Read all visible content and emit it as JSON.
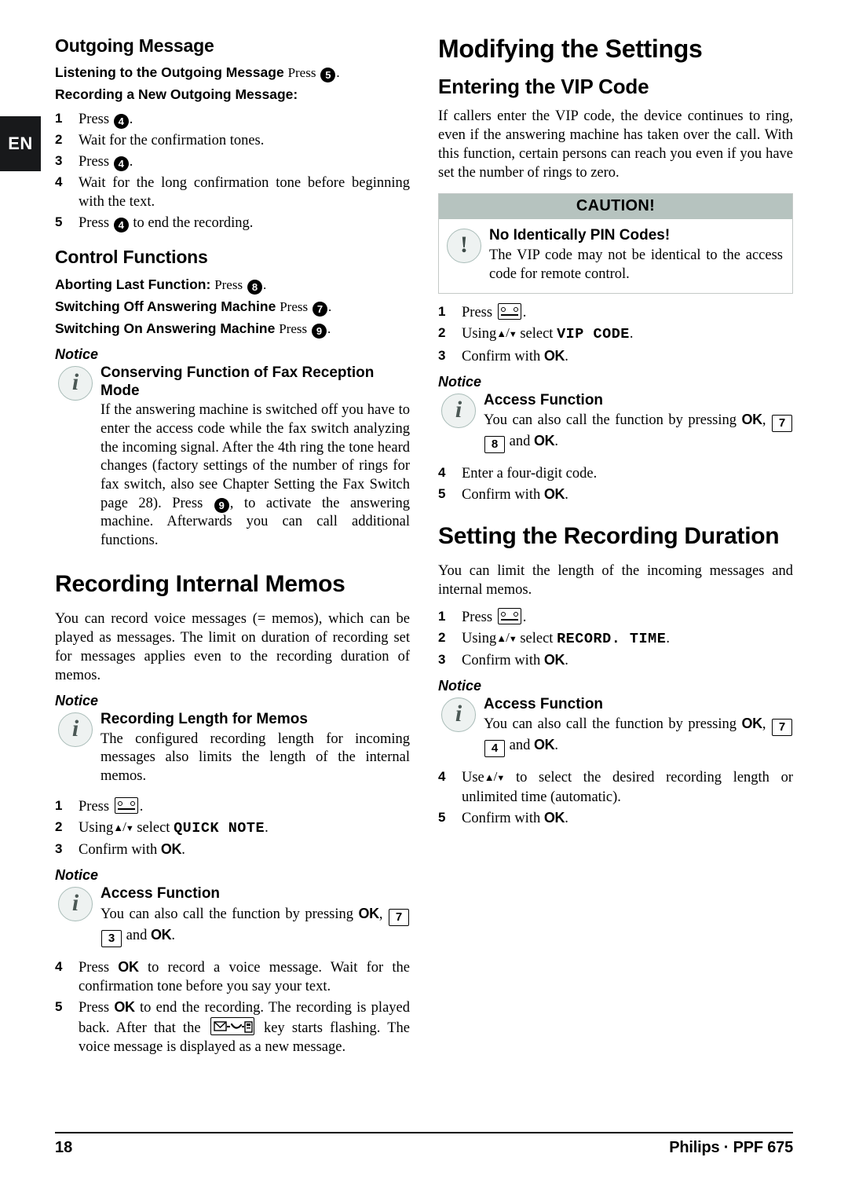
{
  "page": {
    "language_tab": "EN",
    "footer": {
      "page_number": "18",
      "product": "Philips · PPF 675"
    }
  },
  "left_column": {
    "outgoing_message": {
      "heading": "Outgoing Message",
      "listening_label": "Listening to the Outgoing Message",
      "listening_action": "Press",
      "listening_badge": "5",
      "recording_label": "Recording a New Outgoing Message:",
      "steps": [
        {
          "num": "1",
          "pre": "Press",
          "badge": "4",
          "post": "."
        },
        {
          "num": "2",
          "text": "Wait for the confirmation tones."
        },
        {
          "num": "3",
          "pre": "Press",
          "badge": "4",
          "post": "."
        },
        {
          "num": "4",
          "text": "Wait for the long confirmation tone before beginning with the text."
        },
        {
          "num": "5",
          "pre": "Press",
          "badge": "4",
          "post": "to end the recording."
        }
      ]
    },
    "control_functions": {
      "heading": "Control Functions",
      "lines": [
        {
          "label": "Aborting Last Function:",
          "action": "Press",
          "badge": "8"
        },
        {
          "label": "Switching Off Answering Machine",
          "action": "Press",
          "badge": "7"
        },
        {
          "label": "Switching On Answering Machine",
          "action": "Press",
          "badge": "9"
        }
      ],
      "notice": {
        "label": "Notice",
        "icon": "info-icon",
        "title": "Conserving Function of Fax Reception Mode",
        "text_part1": "If the answering machine is switched off you have to enter the access code while the fax switch analyzing the incoming signal. After the 4th ring the tone heard changes (factory settings of the number of rings for fax switch, also see Chapter Setting the Fax Switch page 28). Press",
        "badge": "9",
        "text_part2": ", to activate the answering machine. Afterwards you can call additional functions."
      }
    },
    "recording_internal_memos": {
      "heading": "Recording Internal Memos",
      "intro": "You can record voice messages (= memos), which can be played as messages. The limit on duration of recording set for messages applies even to the recording duration of memos.",
      "notice1": {
        "label": "Notice",
        "icon": "info-icon",
        "title": "Recording Length for Memos",
        "text": "The configured recording length for incoming messages also limits the length of the internal memos."
      },
      "steps_1_3": [
        {
          "num": "1",
          "pre": "Press",
          "icon": "answering-machine-key-icon",
          "post": "."
        },
        {
          "num": "2",
          "pre": "Using",
          "arrows": "up-down-arrows",
          "mid": "select",
          "mono": "QUICK NOTE",
          "post": "."
        },
        {
          "num": "3",
          "pre": "Confirm with",
          "ok": "OK",
          "post": "."
        }
      ],
      "notice2": {
        "label": "Notice",
        "icon": "info-icon",
        "title": "Access Function",
        "text_pre": "You can also call the function by pressing",
        "ok1": "OK",
        "key1": "7",
        "key2": "3",
        "and": "and",
        "ok2": "OK",
        "post": "."
      },
      "steps_4_5": [
        {
          "num": "4",
          "pre": "Press",
          "ok": "OK",
          "post": "to record a voice message. Wait for the confirmation tone before you say your text."
        },
        {
          "num": "5",
          "pre": "Press",
          "ok": "OK",
          "mid": "to end the recording. The recording is played back. After that the",
          "icon": "message-key-icon",
          "post": "key starts flashing. The voice message is displayed as a new message."
        }
      ]
    }
  },
  "right_column": {
    "modifying_the_settings": {
      "heading": "Modifying the Settings"
    },
    "entering_vip_code": {
      "heading": "Entering the VIP Code",
      "intro": "If callers enter the VIP code, the device continues to ring, even if the answering machine has taken over the call. With this function, certain persons can reach you even if you have set the number of rings to zero.",
      "caution": {
        "header": "CAUTION!",
        "icon": "warning-icon",
        "title": "No Identically PIN Codes!",
        "text": "The VIP code may not be identical to the access code for remote control."
      },
      "steps_1_3": [
        {
          "num": "1",
          "pre": "Press",
          "icon": "answering-machine-key-icon",
          "post": "."
        },
        {
          "num": "2",
          "pre": "Using",
          "arrows": "up-down-arrows",
          "mid": "select",
          "mono": "VIP CODE",
          "post": "."
        },
        {
          "num": "3",
          "pre": "Confirm with",
          "ok": "OK",
          "post": "."
        }
      ],
      "notice": {
        "label": "Notice",
        "icon": "info-icon",
        "title": "Access Function",
        "text_pre": "You can also call the function by pressing",
        "ok1": "OK",
        "key1": "7",
        "key2": "8",
        "and": "and",
        "ok2": "OK",
        "post": "."
      },
      "steps_4_5": [
        {
          "num": "4",
          "text": "Enter a four-digit code."
        },
        {
          "num": "5",
          "pre": "Confirm with",
          "ok": "OK",
          "post": "."
        }
      ]
    },
    "setting_recording_duration": {
      "heading": "Setting the Recording Duration",
      "intro": "You can limit the length of the incoming messages and internal memos.",
      "steps_1_3": [
        {
          "num": "1",
          "pre": "Press",
          "icon": "answering-machine-key-icon",
          "post": "."
        },
        {
          "num": "2",
          "pre": "Using",
          "arrows": "up-down-arrows",
          "mid": "select",
          "mono": "RECORD. TIME",
          "post": "."
        },
        {
          "num": "3",
          "pre": "Confirm with",
          "ok": "OK",
          "post": "."
        }
      ],
      "notice": {
        "label": "Notice",
        "icon": "info-icon",
        "title": "Access Function",
        "text_pre": "You can also call the function by pressing",
        "ok1": "OK",
        "key1": "7",
        "key2": "4",
        "and": "and",
        "ok2": "OK",
        "post": "."
      },
      "steps_4_5": [
        {
          "num": "4",
          "pre": "Use",
          "arrows": "up-down-arrows",
          "post": "to select the desired recording length or unlimited time (automatic)."
        },
        {
          "num": "5",
          "pre": "Confirm with",
          "ok": "OK",
          "post": "."
        }
      ]
    }
  },
  "colors": {
    "caution_header_bg": "#b6c3bf",
    "icon_circle_bg": "#eef2f1",
    "icon_circle_border": "#a9bcb8",
    "icon_glyph": "#4b5855",
    "lang_tab_bg": "#18191b"
  }
}
